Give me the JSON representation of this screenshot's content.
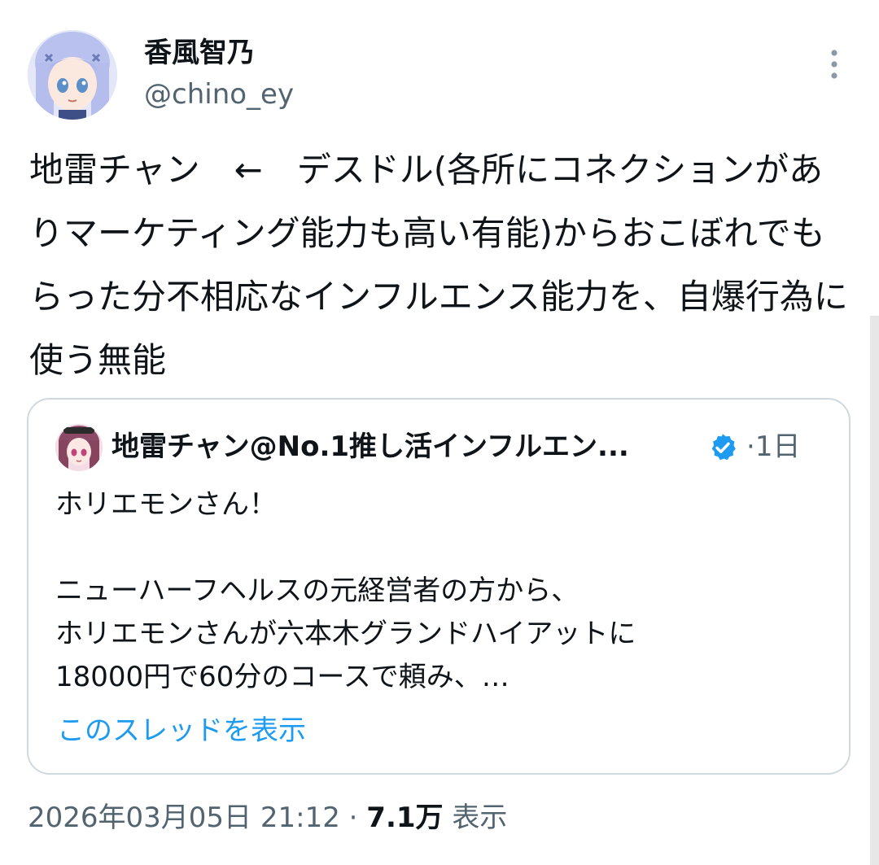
{
  "author": {
    "display_name": "香風智乃",
    "handle": "@chino_ey"
  },
  "tweet": {
    "text": "地雷チャン　←　デスドル(各所にコネクションがありマーケティング能力も高い有能)からおこぼれでもらった分不相応なインフルエンス能力を、自爆行為に使う無能"
  },
  "quote": {
    "display_name": "地雷チャン@No.1推し活インフルエン...",
    "separator": "·",
    "time": "1日",
    "text": "ホリエモンさん！\n\nニューハーフヘルスの元経営者の方から、\nホリエモンさんが六本木グランドハイアットに\n18000円で60分のコースで頼み、…",
    "show_thread": "このスレッドを表示"
  },
  "footer": {
    "timestamp": "2026年03月05日 21:12",
    "separator": "·",
    "views_count": "7.1万",
    "views_label": "表示"
  },
  "icons": {
    "more": "more-vertical-icon",
    "verified": "verified-badge-icon"
  },
  "colors": {
    "text": "#0f1419",
    "secondary": "#536471",
    "link": "#1d9bf0",
    "border": "#cfd9de"
  }
}
